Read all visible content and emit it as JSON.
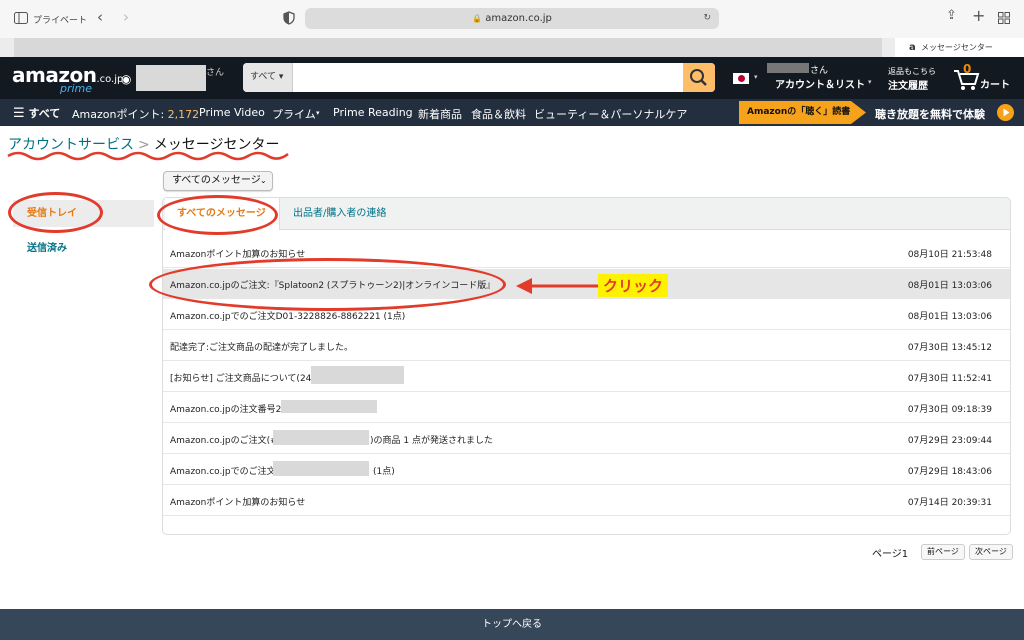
{
  "browser": {
    "private_label": "プライベート",
    "url": "amazon.co.jp",
    "tab_title": "メッセージセンター"
  },
  "header": {
    "logo": "amazon",
    "logo_suffix": ".co.jp",
    "logo_sub": "prime",
    "deliver_suffix": "さん",
    "search_category": "すべて",
    "account_greeting_suffix": "さん",
    "account_label": "アカウント＆リスト",
    "returns_top": "返品もこちら",
    "returns_label": "注文履歴",
    "cart_count": "0",
    "cart_label": "カート"
  },
  "subnav": {
    "all_label": "すべて",
    "points_label": "Amazonポイント: ",
    "points_value": "2,172",
    "items": [
      "Prime Video",
      "プライム",
      "Prime Reading",
      "新着商品",
      "食品＆飲料",
      "ビューティー＆パーソナルケア"
    ],
    "promo_badge": "Amazonの「聴く」読書",
    "promo_text": "聴き放題を無料で体験"
  },
  "breadcrumb": {
    "parent": "アカウントサービス",
    "current": "メッセージセンター"
  },
  "filter": {
    "selected": "すべてのメッセージ"
  },
  "sidebar": {
    "inbox": "受信トレイ",
    "sent": "送信済み"
  },
  "tabs": [
    "すべてのメッセージ",
    "出品者/購入者の連絡"
  ],
  "messages": [
    {
      "subject": "Amazonポイント加算のお知らせ",
      "date": "08月10日 21:53:48"
    },
    {
      "subject": "Amazon.co.jpのご注文:『Splatoon2 (スプラトゥーン2)|オンラインコード版』",
      "date": "08月01日 13:03:06"
    },
    {
      "subject": "Amazon.co.jpでのご注文D01-3228826-8862221 (1点)",
      "date": "08月01日 13:03:06"
    },
    {
      "subject": "配達完了:ご注文商品の配達が完了しました。",
      "date": "07月30日 13:45:12"
    },
    {
      "subject": "[お知らせ] ご注文商品について(249-",
      "date": "07月30日 11:52:41"
    },
    {
      "subject": "Amazon.co.jpの注文番号24",
      "date": "07月30日 09:18:39"
    },
    {
      "subject": "Amazon.co.jpのご注文(#2",
      "subject_tail": ")の商品 1 点が発送されました",
      "date": "07月29日 23:09:44"
    },
    {
      "subject": "Amazon.co.jpでのご注文2",
      "subject_tail": "(1点)",
      "date": "07月29日 18:43:06"
    },
    {
      "subject": "Amazonポイント加算のお知らせ",
      "date": "07月14日 20:39:31"
    }
  ],
  "pager": {
    "page_label": "ページ1",
    "prev": "前ページ",
    "next": "次ページ"
  },
  "annotation": {
    "callout": "クリック"
  },
  "footer": {
    "back_to_top": "トップへ戻る"
  },
  "colors": {
    "accent": "#e47911",
    "link": "#007185",
    "annotation": "#e23b2a",
    "highlight": "#fff200"
  }
}
